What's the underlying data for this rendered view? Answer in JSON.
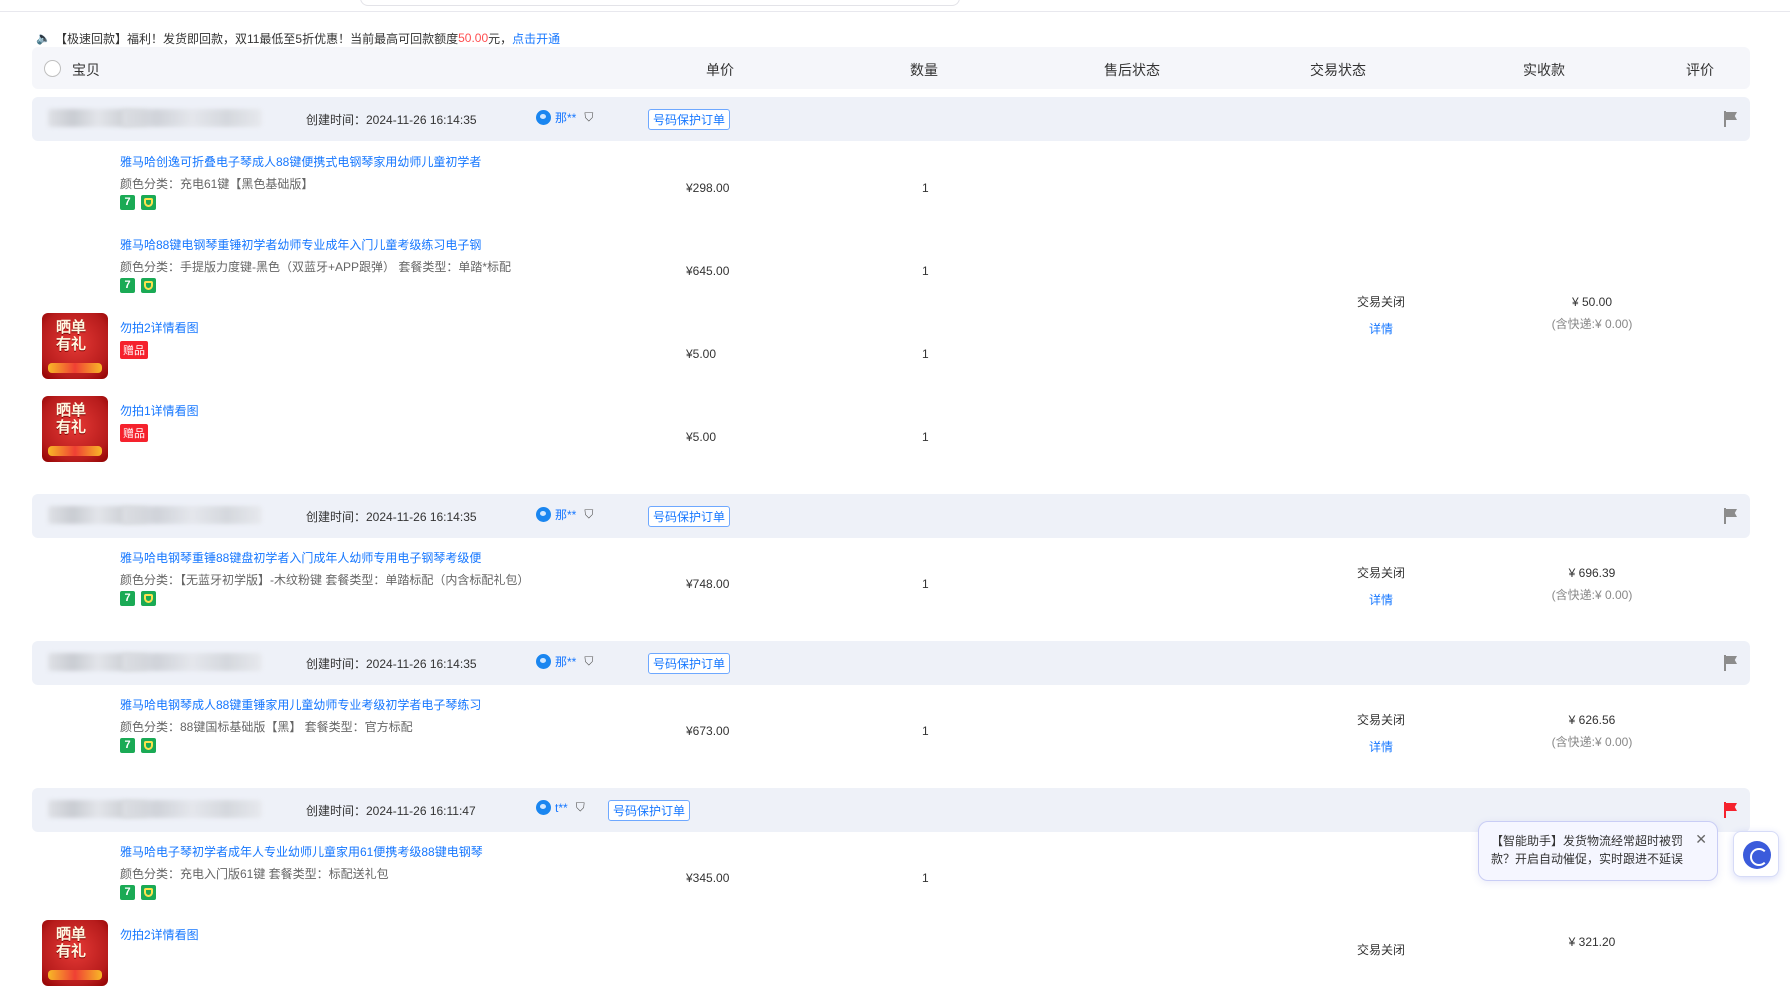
{
  "notice": {
    "prefix": "【极速回款】福利！发货即回款，双11最低至5折优惠！当前最高可回款额度",
    "amount": "50.00",
    "suffix": "元，",
    "link": "点击开通"
  },
  "table_header": {
    "item": "宝贝",
    "price": "单价",
    "qty": "数量",
    "after_sale": "售后状态",
    "trade_status": "交易状态",
    "received": "实收款",
    "review": "评价"
  },
  "orders": [
    {
      "created_label": "创建时间：2024-11-26 16:14:35",
      "buyer": "那**",
      "protect": "号码保护订单",
      "flag": "gray",
      "status": "交易关闭",
      "detail": "详情",
      "paid": "¥ 50.00",
      "ship": "(含快递:¥ 0.00)",
      "items": [
        {
          "title": "雅马哈创逸可折叠电子琴成人88键便携式电钢琴家用幼师儿童初学者",
          "sku": "颜色分类：充电61键【黑色基础版】",
          "price": "¥298.00",
          "qty": "1",
          "type": "normal"
        },
        {
          "title": "雅马哈88键电钢琴重锤初学者幼师专业成年入门儿童考级练习电子钢",
          "sku": "颜色分类：手提版力度键-黑色（双蓝牙+APP跟弹）   套餐类型：单踏*标配",
          "price": "¥645.00",
          "qty": "1",
          "type": "normal"
        },
        {
          "title": "勿拍2详情看图",
          "gift": "赠品",
          "price": "¥5.00",
          "qty": "1",
          "type": "gift"
        },
        {
          "title": "勿拍1详情看图",
          "gift": "赠品",
          "price": "¥5.00",
          "qty": "1",
          "type": "gift"
        }
      ]
    },
    {
      "created_label": "创建时间：2024-11-26 16:14:35",
      "buyer": "那**",
      "protect": "号码保护订单",
      "flag": "gray",
      "status": "交易关闭",
      "detail": "详情",
      "paid": "¥ 696.39",
      "ship": "(含快递:¥ 0.00)",
      "items": [
        {
          "title": "雅马哈电钢琴重锤88键盘初学者入门成年人幼师专用电子钢琴考级便",
          "sku": "颜色分类：【无蓝牙初学版】-木纹粉键   套餐类型：单踏标配（内含标配礼包）",
          "price": "¥748.00",
          "qty": "1",
          "type": "normal"
        }
      ]
    },
    {
      "created_label": "创建时间：2024-11-26 16:14:35",
      "buyer": "那**",
      "protect": "号码保护订单",
      "flag": "gray",
      "status": "交易关闭",
      "detail": "详情",
      "paid": "¥ 626.56",
      "ship": "(含快递:¥ 0.00)",
      "items": [
        {
          "title": "雅马哈电钢琴成人88键重锤家用儿童幼师专业考级初学者电子琴练习",
          "sku": "颜色分类：88键国标基础版【黑】   套餐类型：官方标配",
          "price": "¥673.00",
          "qty": "1",
          "type": "normal"
        }
      ]
    },
    {
      "created_label": "创建时间：2024-11-26 16:11:47",
      "buyer": "t**",
      "protect": "号码保护订单",
      "flag": "red",
      "status": "交易关闭",
      "paid": "¥ 321.20",
      "items": [
        {
          "title": "雅马哈电子琴初学者成年人专业幼师儿童家用61便携考级88键电钢琴",
          "sku": "颜色分类：充电入门版61键   套餐类型：标配送礼包",
          "price": "¥345.00",
          "qty": "1",
          "type": "normal"
        },
        {
          "title": "勿拍2详情看图",
          "type": "gift"
        }
      ]
    }
  ],
  "thumb_text": {
    "line1": "晒单",
    "line2": "有礼"
  },
  "assistant_tip": {
    "text": "【智能助手】发货物流经常超时被罚款？开启自动催促，实时跟进不延误",
    "close": "✕"
  },
  "icons": {
    "speaker": "speaker-icon",
    "filter": "filter-icon",
    "flag": "flag-icon",
    "seven": "7"
  },
  "colors": {
    "link": "#1677ff",
    "amount": "#ff4d4f",
    "gift": "#f5222d",
    "flag_red": "#f5222d"
  }
}
